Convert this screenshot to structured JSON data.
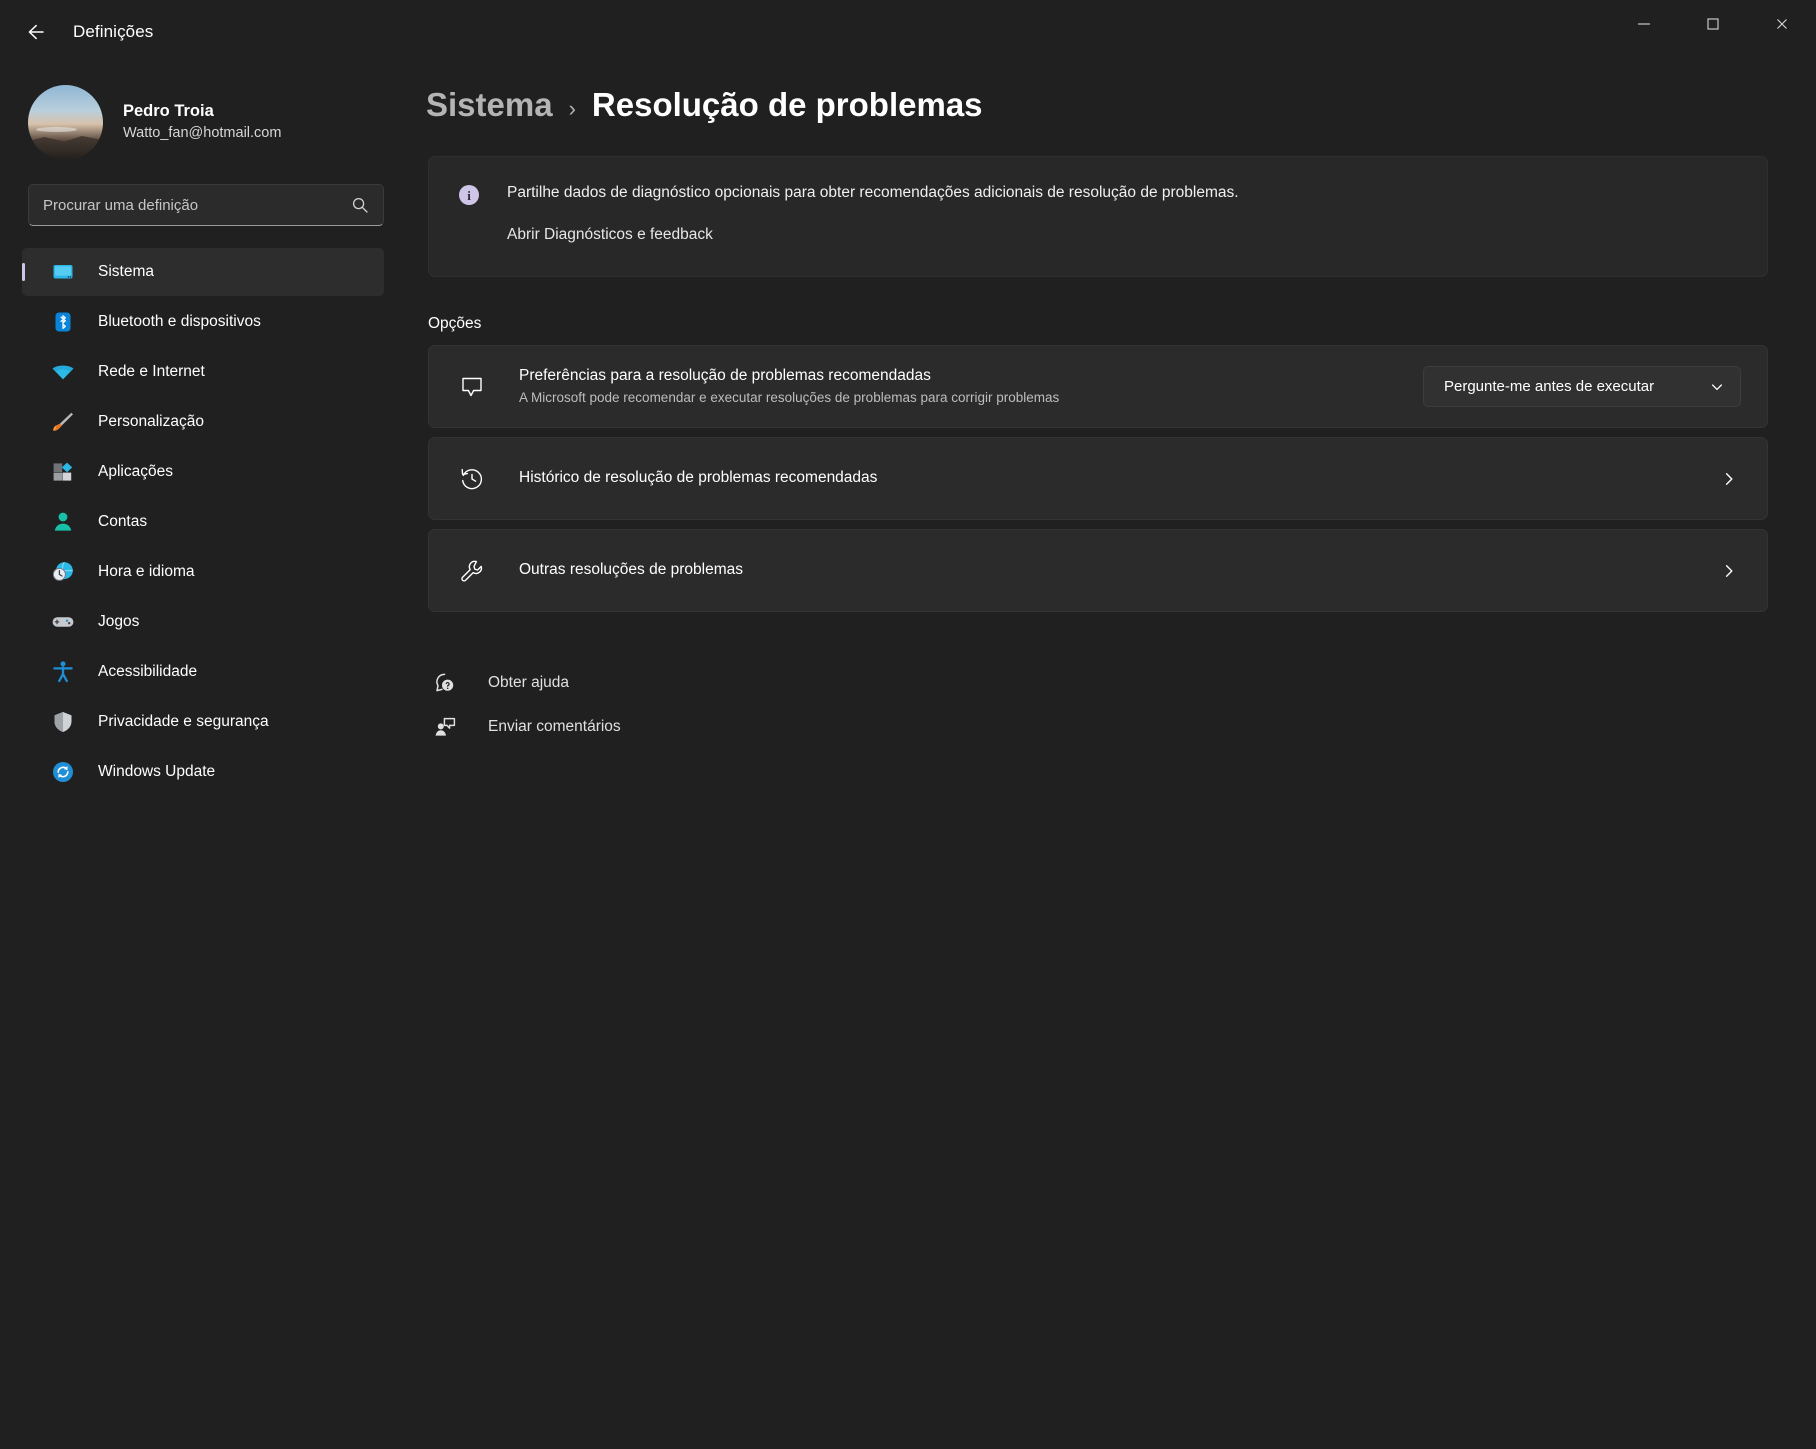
{
  "window": {
    "app_title": "Definições",
    "back_icon": "arrow-left-icon",
    "controls": {
      "minimize": "minimize-icon",
      "maximize": "maximize-icon",
      "close": "close-icon"
    }
  },
  "sidebar": {
    "profile": {
      "name": "Pedro Troia",
      "email": "Watto_fan@hotmail.com",
      "avatar": "user-avatar"
    },
    "search": {
      "placeholder": "Procurar uma definição",
      "value": "",
      "icon": "search-icon"
    },
    "items": [
      {
        "label": "Sistema",
        "icon": "monitor-icon",
        "selected": true
      },
      {
        "label": "Bluetooth e dispositivos",
        "icon": "bluetooth-icon",
        "selected": false
      },
      {
        "label": "Rede e Internet",
        "icon": "wifi-icon",
        "selected": false
      },
      {
        "label": "Personalização",
        "icon": "paintbrush-icon",
        "selected": false
      },
      {
        "label": "Aplicações",
        "icon": "apps-icon",
        "selected": false
      },
      {
        "label": "Contas",
        "icon": "person-icon",
        "selected": false
      },
      {
        "label": "Hora e idioma",
        "icon": "clock-globe-icon",
        "selected": false
      },
      {
        "label": "Jogos",
        "icon": "gamepad-icon",
        "selected": false
      },
      {
        "label": "Acessibilidade",
        "icon": "accessibility-icon",
        "selected": false
      },
      {
        "label": "Privacidade e segurança",
        "icon": "shield-icon",
        "selected": false
      },
      {
        "label": "Windows Update",
        "icon": "update-refresh-icon",
        "selected": false
      }
    ]
  },
  "main": {
    "breadcrumb": {
      "parent": "Sistema",
      "separator": "›",
      "current": "Resolução de problemas"
    },
    "banner": {
      "icon": "info-icon",
      "text": "Partilhe dados de diagnóstico opcionais para obter recomendações adicionais de resolução de problemas.",
      "link": "Abrir Diagnósticos e feedback"
    },
    "section_title": "Opções",
    "cards": [
      {
        "icon": "callout-bubble-icon",
        "title": "Preferências para a resolução de problemas recomendadas",
        "subtitle": "A Microsoft pode recomendar e executar resoluções de problemas para corrigir problemas",
        "control": "dropdown",
        "dropdown_value": "Pergunte-me antes de executar",
        "dropdown_icon": "chevron-down-icon"
      },
      {
        "icon": "history-clock-icon",
        "title": "Histórico de resolução de problemas recomendadas",
        "subtitle": "",
        "control": "chevron",
        "chevron_icon": "chevron-right-icon"
      },
      {
        "icon": "wrench-icon",
        "title": "Outras resoluções de problemas",
        "subtitle": "",
        "control": "chevron",
        "chevron_icon": "chevron-right-icon"
      }
    ],
    "footer_links": [
      {
        "label": "Obter ajuda",
        "icon": "help-question-icon"
      },
      {
        "label": "Enviar comentários",
        "icon": "feedback-person-icon"
      }
    ]
  },
  "colors": {
    "window_bg": "#202020",
    "card_bg": "#2b2b2b",
    "banner_bg": "#282828",
    "accent_bar": "#cfc5e8",
    "text_primary": "#ffffff",
    "text_secondary": "#bdbdbd",
    "breadcrumb_parent": "#b4b4b4"
  }
}
